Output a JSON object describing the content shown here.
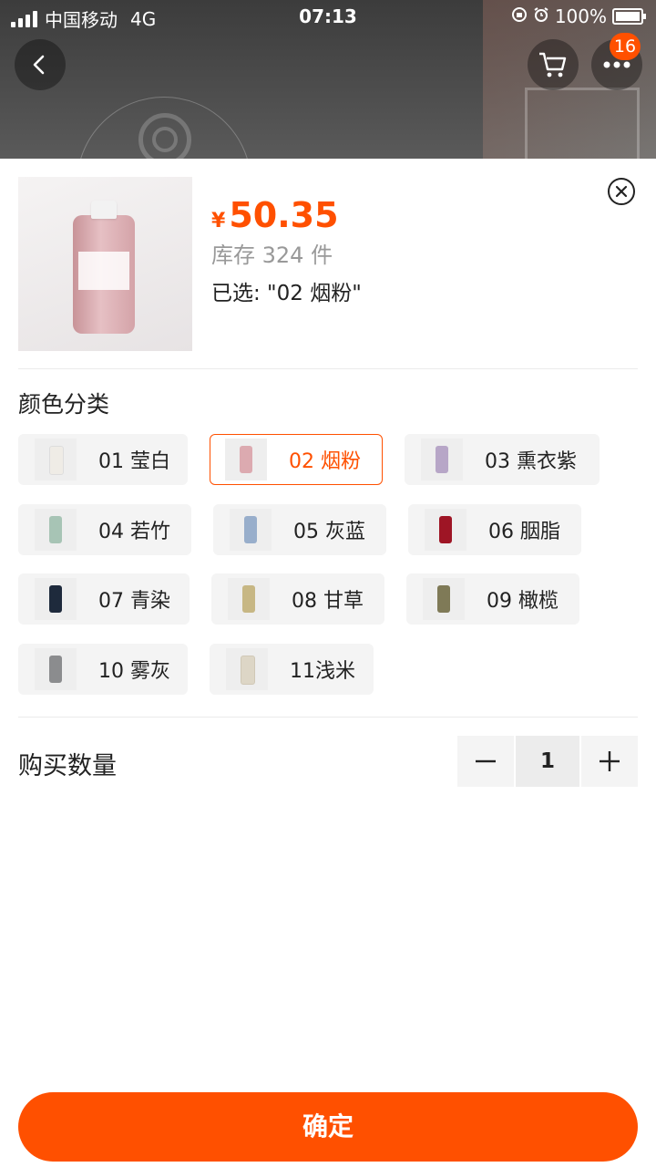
{
  "status_bar": {
    "carrier": "中国移动",
    "network": "4G",
    "time": "07:13",
    "battery": "100%"
  },
  "header": {
    "cart_badge": "16",
    "icons": [
      "back-icon",
      "cart-icon",
      "more-icon"
    ]
  },
  "product": {
    "currency": "¥",
    "price": "50.35",
    "stock": "库存 324 件",
    "selected_text": "已选: \"02 烟粉\""
  },
  "options": {
    "title": "颜色分类",
    "selected": "02 烟粉",
    "items": [
      {
        "label": "01 莹白",
        "color": "#efece6"
      },
      {
        "label": "02 烟粉",
        "color": "#dcaab0"
      },
      {
        "label": "03 熏衣紫",
        "color": "#b7a6c7"
      },
      {
        "label": "04 若竹",
        "color": "#a7c4b5"
      },
      {
        "label": "05 灰蓝",
        "color": "#98aecb"
      },
      {
        "label": "06 胭脂",
        "color": "#9e1525"
      },
      {
        "label": "07 青染",
        "color": "#1e2a3c"
      },
      {
        "label": "08 甘草",
        "color": "#c7b784"
      },
      {
        "label": "09 橄榄",
        "color": "#7f7a57"
      },
      {
        "label": "10 雾灰",
        "color": "#8b8c8e"
      },
      {
        "label": "11浅米",
        "color": "#ddd6c6"
      }
    ]
  },
  "quantity": {
    "label": "购买数量",
    "value": "1"
  },
  "actions": {
    "confirm_label": "确定"
  },
  "colors": {
    "accent": "#ff5000"
  }
}
